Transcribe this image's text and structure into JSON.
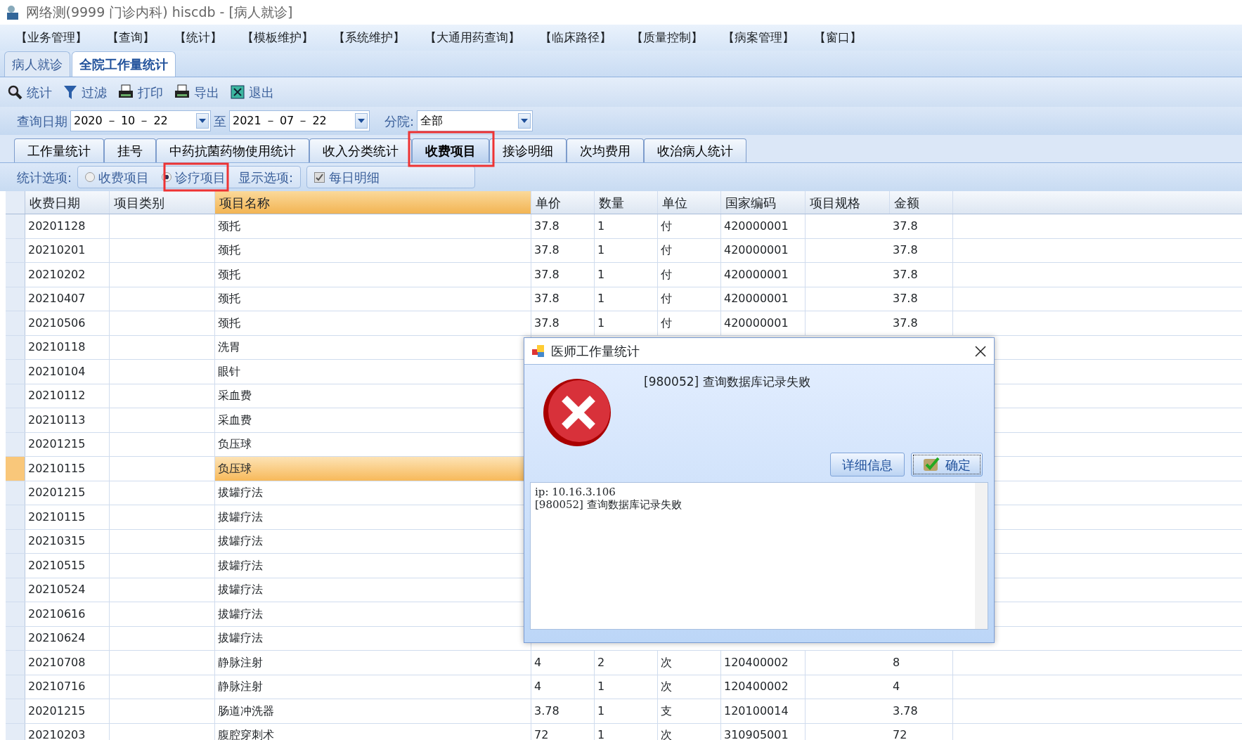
{
  "window": {
    "title": "网络测(9999 门诊内科)  hiscdb - [病人就诊]"
  },
  "menu": [
    "【业务管理】",
    "【查询】",
    "【统计】",
    "【模板维护】",
    "【系统维护】",
    "【大通用药查询】",
    "【临床路径】",
    "【质量控制】",
    "【病案管理】",
    "【窗口】"
  ],
  "doc_tabs": [
    {
      "label": "病人就诊",
      "selected": false
    },
    {
      "label": "全院工作量统计",
      "selected": true
    }
  ],
  "toolbar": [
    {
      "label": "统计",
      "kind": "search"
    },
    {
      "label": "过滤",
      "kind": "filter"
    },
    {
      "label": "打印",
      "kind": "print"
    },
    {
      "label": "导出",
      "kind": "print"
    },
    {
      "label": "退出",
      "kind": "exit"
    }
  ],
  "filters": {
    "date_label": "查询日期",
    "date_from": "2020 － 10 － 22",
    "to_label": "至",
    "date_to": "2021 － 07 － 22",
    "branch_label": "分院:",
    "branch": "全部"
  },
  "tabs": [
    {
      "label": "工作量统计",
      "selected": false
    },
    {
      "label": "挂号",
      "selected": false
    },
    {
      "label": "中药抗菌药物使用统计",
      "selected": false
    },
    {
      "label": "收入分类统计",
      "selected": false
    },
    {
      "label": "收费项目",
      "selected": true
    },
    {
      "label": "接诊明细",
      "selected": false
    },
    {
      "label": "次均费用",
      "selected": false
    },
    {
      "label": "收治病人统计",
      "selected": false
    }
  ],
  "options": {
    "label": "统计选项:",
    "radios": [
      {
        "label": "收费项目",
        "selected": false
      },
      {
        "label": "诊疗项目",
        "selected": true
      }
    ],
    "display_label": "显示选项:",
    "checkbox": {
      "label": "每日明细",
      "checked": true
    }
  },
  "table": {
    "columns": [
      {
        "label": "收费日期",
        "selected": false
      },
      {
        "label": "项目类别",
        "selected": false
      },
      {
        "label": "项目名称",
        "selected": true
      },
      {
        "label": "单价",
        "selected": false
      },
      {
        "label": "数量",
        "selected": false
      },
      {
        "label": "单位",
        "selected": false
      },
      {
        "label": "国家编码",
        "selected": false
      },
      {
        "label": "项目规格",
        "selected": false
      },
      {
        "label": "金额",
        "selected": false
      }
    ],
    "rows": [
      {
        "cells": [
          "20201128",
          "",
          "颈托",
          "37.8",
          "1",
          "付",
          "420000001",
          "",
          "37.8"
        ],
        "selected": false
      },
      {
        "cells": [
          "20210201",
          "",
          "颈托",
          "37.8",
          "1",
          "付",
          "420000001",
          "",
          "37.8"
        ],
        "selected": false
      },
      {
        "cells": [
          "20210202",
          "",
          "颈托",
          "37.8",
          "1",
          "付",
          "420000001",
          "",
          "37.8"
        ],
        "selected": false
      },
      {
        "cells": [
          "20210407",
          "",
          "颈托",
          "37.8",
          "1",
          "付",
          "420000001",
          "",
          "37.8"
        ],
        "selected": false
      },
      {
        "cells": [
          "20210506",
          "",
          "颈托",
          "37.8",
          "1",
          "付",
          "420000001",
          "",
          "37.8"
        ],
        "selected": false
      },
      {
        "cells": [
          "20210118",
          "",
          "洗胃"
        ],
        "selected": false
      },
      {
        "cells": [
          "20210104",
          "",
          "眼针"
        ],
        "selected": false
      },
      {
        "cells": [
          "20210112",
          "",
          "采血费"
        ],
        "selected": false
      },
      {
        "cells": [
          "20210113",
          "",
          "采血费"
        ],
        "selected": false
      },
      {
        "cells": [
          "20201215",
          "",
          "负压球"
        ],
        "selected": false
      },
      {
        "cells": [
          "20210115",
          "",
          "负压球"
        ],
        "selected": true
      },
      {
        "cells": [
          "20201215",
          "",
          "拔罐疗法"
        ],
        "selected": false
      },
      {
        "cells": [
          "20210115",
          "",
          "拔罐疗法"
        ],
        "selected": false
      },
      {
        "cells": [
          "20210315",
          "",
          "拔罐疗法"
        ],
        "selected": false
      },
      {
        "cells": [
          "20210515",
          "",
          "拔罐疗法"
        ],
        "selected": false
      },
      {
        "cells": [
          "20210524",
          "",
          "拔罐疗法"
        ],
        "selected": false
      },
      {
        "cells": [
          "20210616",
          "",
          "拔罐疗法"
        ],
        "selected": false
      },
      {
        "cells": [
          "20210624",
          "",
          "拔罐疗法"
        ],
        "selected": false
      },
      {
        "cells": [
          "20210708",
          "",
          "静脉注射",
          "4",
          "2",
          "次",
          "120400002",
          "",
          "8"
        ],
        "selected": false
      },
      {
        "cells": [
          "20210716",
          "",
          "静脉注射",
          "4",
          "1",
          "次",
          "120400002",
          "",
          "4"
        ],
        "selected": false
      },
      {
        "cells": [
          "20201215",
          "",
          "肠道冲洗器",
          "3.78",
          "1",
          "支",
          "120100014",
          "",
          "3.78"
        ],
        "selected": false
      },
      {
        "cells": [
          "20210203",
          "",
          "腹腔穿刺术",
          "72",
          "1",
          "次",
          "310905001",
          "",
          "72"
        ],
        "selected": false
      }
    ]
  },
  "dialog": {
    "title": "医师工作量统计",
    "message": "[980052] 查询数据库记录失败",
    "buttons": [
      {
        "label": "详细信息",
        "kind": "plain"
      },
      {
        "label": "确定",
        "kind": "default"
      }
    ],
    "details": [
      "ip: 10.16.3.106",
      "[980052] 查询数据库记录失败"
    ]
  }
}
